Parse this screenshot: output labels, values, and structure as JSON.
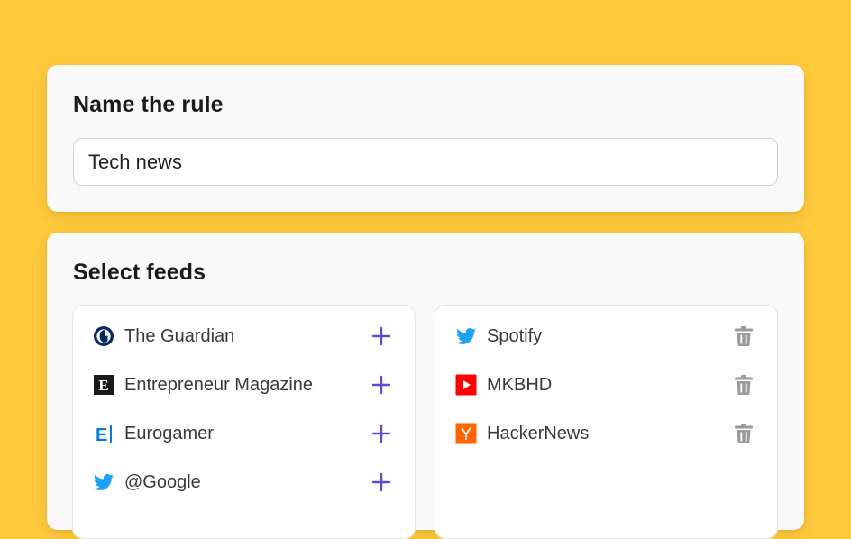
{
  "rule": {
    "title": "Name the rule",
    "name_value": "Tech news"
  },
  "feeds": {
    "title": "Select feeds",
    "available": [
      {
        "label": "The Guardian",
        "icon": "guardian-icon"
      },
      {
        "label": "Entrepreneur Magazine",
        "icon": "entrepreneur-icon"
      },
      {
        "label": "Eurogamer",
        "icon": "eurogamer-icon"
      },
      {
        "label": "@Google",
        "icon": "twitter-icon"
      }
    ],
    "selected": [
      {
        "label": "Spotify",
        "icon": "twitter-icon"
      },
      {
        "label": "MKBHD",
        "icon": "youtube-icon"
      },
      {
        "label": "HackerNews",
        "icon": "hackernews-icon"
      }
    ]
  },
  "colors": {
    "background": "#FFCB3D",
    "accent": "#5B4BD1",
    "twitter": "#1DA1F2",
    "youtube": "#FF0000",
    "hackernews": "#FF6600",
    "eurogamer": "#0A7BD6",
    "trash": "#9A9A9A"
  }
}
